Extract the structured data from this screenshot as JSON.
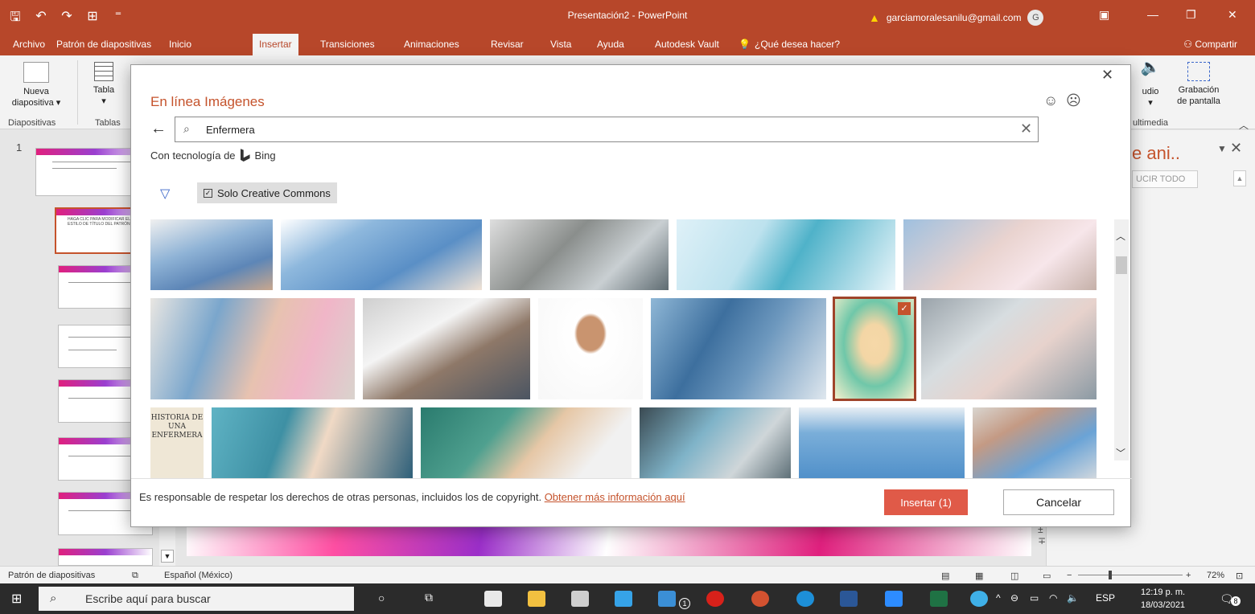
{
  "app": {
    "title": "Presentación2  -  PowerPoint",
    "account": "garciamoralesanilu@gmail.com",
    "avatar_initial": "G",
    "accent": "#b7472a"
  },
  "ribbon_tabs": [
    "Archivo",
    "Patrón de diapositivas",
    "Inicio",
    "Insertar",
    "Transiciones",
    "Animaciones",
    "Revisar",
    "Vista",
    "Ayuda",
    "Autodesk Vault"
  ],
  "active_tab": "Insertar",
  "tell_me": "¿Qué desea hacer?",
  "share": "Compartir",
  "ribbon": {
    "new_slide_line1": "Nueva",
    "new_slide_line2": "diapositiva ▾",
    "group_slides": "Diapositivas",
    "table": "Tabla",
    "group_tables": "Tablas",
    "audio": "udio",
    "screen_rec_line1": "Grabación",
    "screen_rec_line2": "de pantalla",
    "group_multimedia": "ultimedia"
  },
  "slide_panel": {
    "first_slide_number": "1",
    "slide_title_text": "HAGA CLIC PARA MODIFICAR EL ESTILO DE TÍTULO DEL PATRÓN"
  },
  "animation_pane": {
    "title": "e ani..",
    "play_all": "UCIR TODO"
  },
  "dialog": {
    "title": "En línea Imágenes",
    "search_value": "Enfermera",
    "powered_by": "Con tecnología de",
    "engine": "Bing",
    "filter_chip": "Solo Creative Commons",
    "copyright_text": "Es responsable de respetar los derechos de otras personas, incluidos los de copyright.",
    "copyright_link": "Obtener más información aquí",
    "insert_button": "Insertar (1)",
    "cancel_button": "Cancelar",
    "book_cover_text": "HISTORIA DE UNA ENFERMERA",
    "selected_count": 1
  },
  "statusbar": {
    "view": "Patrón de diapositivas",
    "language": "Español (México)",
    "zoom": "72%"
  },
  "taskbar": {
    "search_placeholder": "Escribe aquí para buscar",
    "language": "ESP",
    "time": "12:19 p. m.",
    "date": "18/03/2021",
    "notifications": "8",
    "mail_badge": "1"
  }
}
